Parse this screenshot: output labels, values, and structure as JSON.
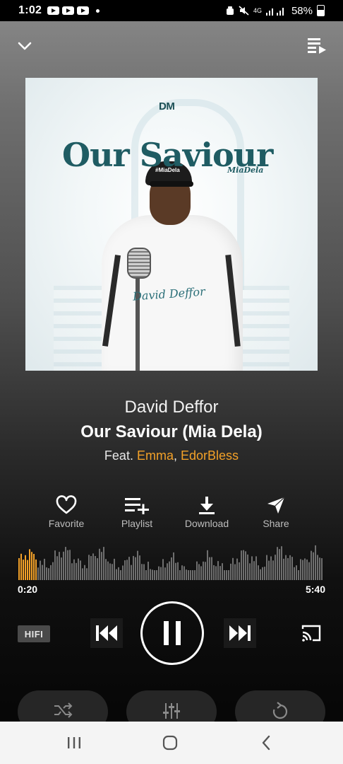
{
  "status_bar": {
    "time": "1:02",
    "battery_text": "58%",
    "network": "4G",
    "notification_icons": [
      "youtube-icon",
      "youtube-icon",
      "youtube-icon"
    ]
  },
  "artwork": {
    "logo_text": "DM",
    "title_text": "Our Saviour",
    "subtitle_text": "MiaDela",
    "signature_text": "David Deffor",
    "cap_text": "#MiaDela"
  },
  "track": {
    "artist": "David Deffor",
    "title": "Our Saviour (Mia Dela)",
    "feat_prefix": "Feat.",
    "feat_artists": [
      "Emma",
      "EdorBless"
    ],
    "feat_separator": ","
  },
  "actions": [
    {
      "label": "Favorite",
      "icon": "heart-icon"
    },
    {
      "label": "Playlist",
      "icon": "playlist-add-icon"
    },
    {
      "label": "Download",
      "icon": "download-icon"
    },
    {
      "label": "Share",
      "icon": "share-icon"
    }
  ],
  "playback": {
    "current_time": "0:20",
    "total_time": "5:40",
    "progress_fraction": 0.06,
    "quality_label": "HIFI",
    "state": "playing"
  },
  "colors": {
    "accent": "#f3a128",
    "waveform_played": "#f3a128",
    "waveform_unplayed": "#6f6f6f"
  },
  "bottom_controls": [
    {
      "icon": "shuffle-icon"
    },
    {
      "icon": "equalizer-icon"
    },
    {
      "icon": "repeat-icon"
    }
  ],
  "nav": [
    {
      "icon": "recent-apps-icon"
    },
    {
      "icon": "home-icon"
    },
    {
      "icon": "back-icon"
    }
  ]
}
